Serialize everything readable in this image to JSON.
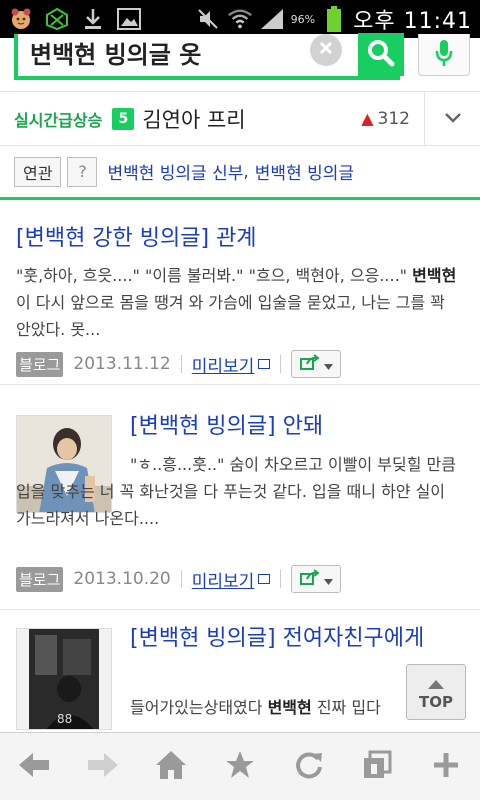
{
  "status_bar": {
    "battery_percent": "96%",
    "time": "오후 11:41",
    "icons": [
      "face-notification-icon",
      "exo-logo-icon",
      "download-icon",
      "image-icon",
      "mute-icon",
      "wifi-icon",
      "signal-icon",
      "battery-icon"
    ]
  },
  "search": {
    "query": "변백현 빙의글 옷",
    "icons": [
      "clear-icon",
      "search-icon",
      "microphone-icon"
    ],
    "accent_color": "#19ce60"
  },
  "realtime": {
    "label": "실시간급상승",
    "rank": "5",
    "keyword": "김연아 프리",
    "arrow": "▲",
    "count": "312"
  },
  "related": {
    "tag": "연관",
    "help": "?",
    "links": [
      "변백현 빙의글 신부",
      "변백현 빙의글"
    ],
    "separator": ","
  },
  "results": [
    {
      "title": "[변백현 강한 빙의글] 관계",
      "body_before": "\"훗,하아, 흐읏....\" \"이름 불러봐.\" \"흐으, 백현아, 으응....\" ",
      "body_bold": "변백현",
      "body_after": "이 다시 앞으로 몸을 땡겨 와 가슴에 입술을 묻었고, 나는 그를 꽉 안았다. 못...",
      "source": "블로그",
      "date": "2013.11.12",
      "preview": "미리보기"
    },
    {
      "title": "[변백현 빙의글] 안돼",
      "body": "\"ㅎ..흥...훗..\" 숨이 차오르고 이빨이 부딪힐 만큼 입을 맞추는 너 꼭 화난것을 다 푸는것 같다. 입을 때니 하얀 실이 가느라져서 나온다....",
      "source": "블로그",
      "date": "2013.10.20",
      "preview": "미리보기"
    },
    {
      "title": "[변백현 빙의글] 전여자친구에게",
      "body_before": "들어가있는상태였다 ",
      "body_bold": "변백현",
      "body_after": " 진짜 밉다"
    }
  ],
  "top_button": {
    "label": "TOP"
  },
  "toolbar": {
    "buttons": [
      "back-icon",
      "forward-icon",
      "home-icon",
      "bookmark-star-icon",
      "refresh-icon",
      "tabs-icon",
      "add-icon"
    ]
  }
}
